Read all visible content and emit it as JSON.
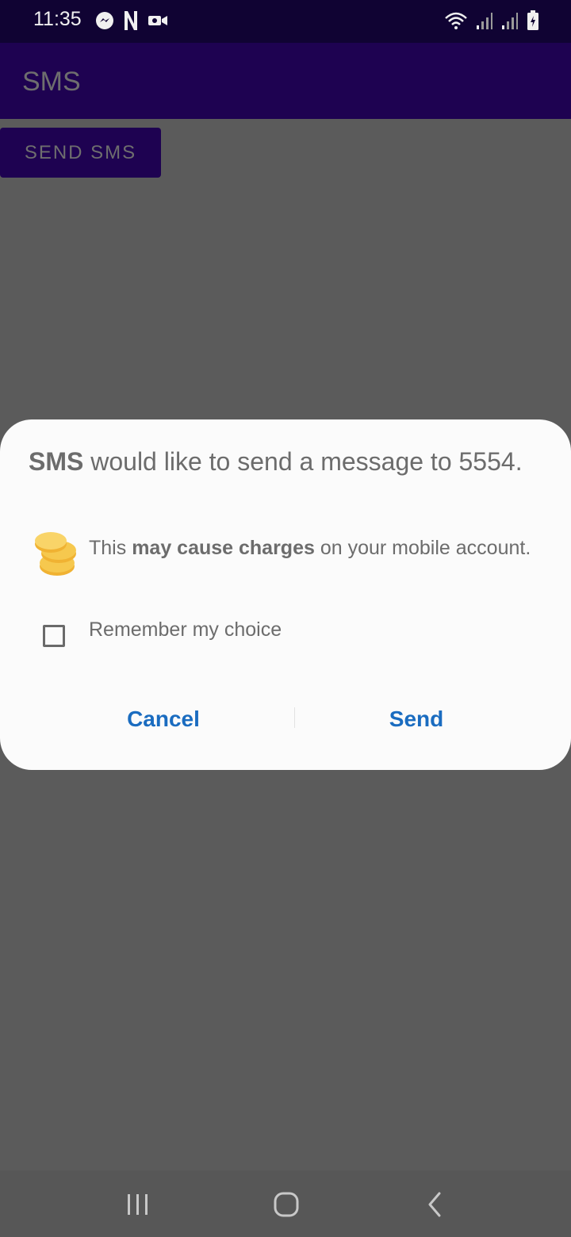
{
  "status_bar": {
    "time": "11:35",
    "left_icons": [
      "messenger-icon",
      "netflix-icon",
      "video-call-icon"
    ],
    "right_icons": [
      "wifi-icon",
      "signal-icon",
      "signal-icon",
      "battery-charging-icon"
    ]
  },
  "app_bar": {
    "title": "SMS"
  },
  "main": {
    "send_button_label": "SEND SMS"
  },
  "dialog": {
    "title_app": "SMS",
    "title_rest": " would like to send a message to 5554.",
    "charge_prefix": "This ",
    "charge_bold": "may cause charges",
    "charge_suffix": " on your mobile account.",
    "remember_label": "Remember my choice",
    "remember_checked": false,
    "cancel_label": "Cancel",
    "send_label": "Send"
  },
  "nav_bar": {
    "icons": [
      "recents-icon",
      "home-icon",
      "back-icon"
    ]
  },
  "colors": {
    "status_bar": "#100333",
    "app_bar": "#1e0251",
    "scrim": "#5b5b5b",
    "dialog_bg": "#fbfbfb",
    "action_text": "#1a6cc0",
    "coin": "#f4c14a"
  }
}
